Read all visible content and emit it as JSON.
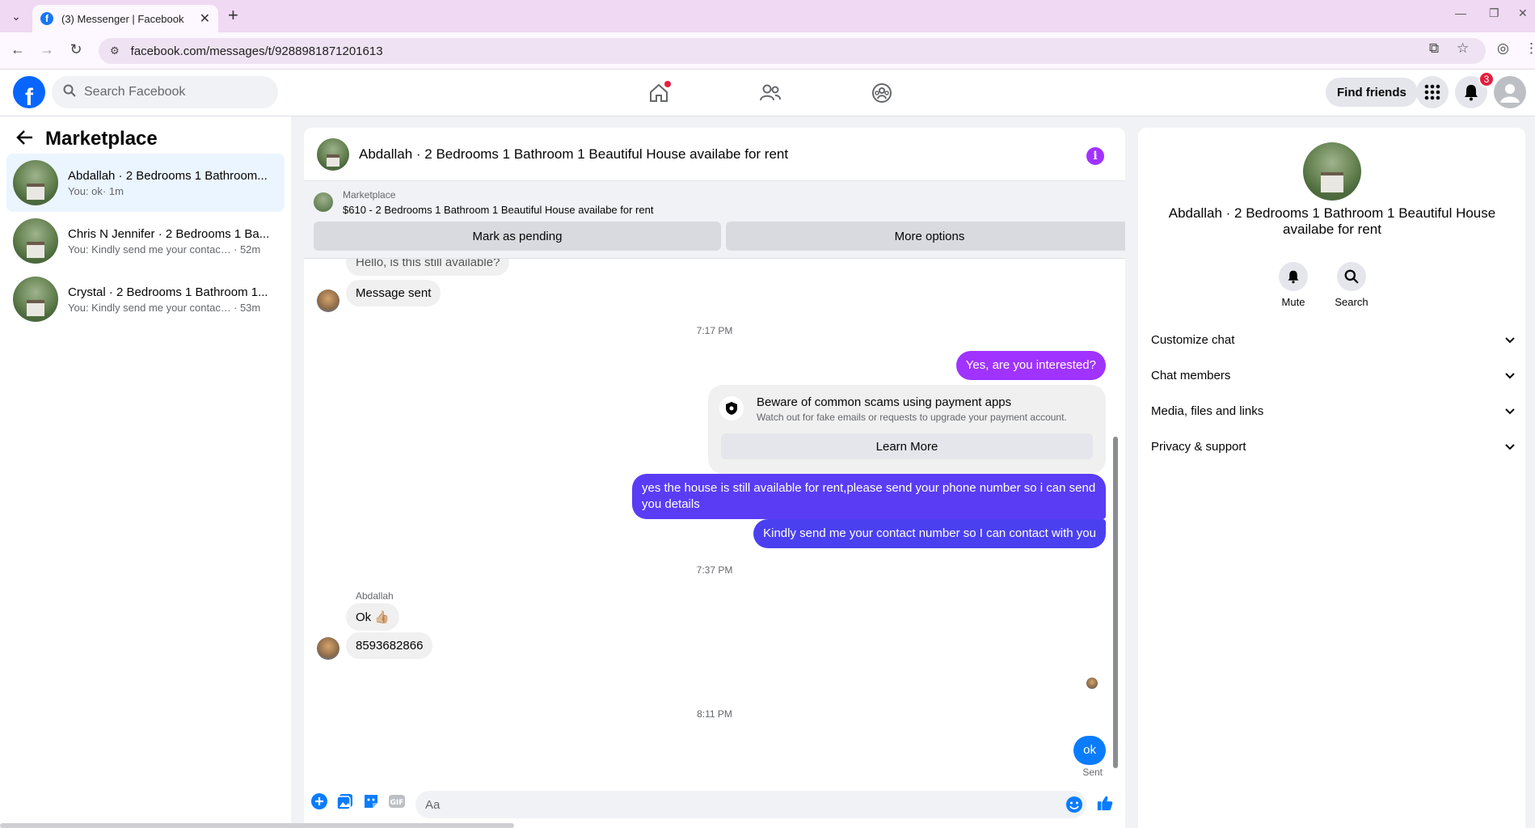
{
  "browser": {
    "tab_title": "(3) Messenger | Facebook",
    "url": "facebook.com/messages/t/9288981871201613",
    "new_tab": "+",
    "close": "✕"
  },
  "header": {
    "search_placeholder": "Search Facebook",
    "find_friends": "Find friends",
    "notification_count": "3"
  },
  "sidebar": {
    "title": "Marketplace",
    "conversations": [
      {
        "name": "Abdallah · 2 Bedrooms 1 Bathroom...",
        "snippet": "You: ok",
        "time": "· 1m",
        "active": true
      },
      {
        "name": "Chris N Jennifer · 2 Bedrooms 1 Ba...",
        "snippet": "You: Kindly send me your contact n...",
        "time": "· 52m",
        "active": false
      },
      {
        "name": "Crystal · 2 Bedrooms 1 Bathroom 1...",
        "snippet": "You: Kindly send me your contact n...",
        "time": "· 53m",
        "active": false
      }
    ]
  },
  "chat": {
    "title": "Abdallah · 2 Bedrooms 1 Bathroom 1 Beautiful House availabe for rent",
    "marketplace_label": "Marketplace",
    "listing": "$610 - 2 Bedrooms 1 Bathroom 1 Beautiful House availabe for rent",
    "mark_pending": "Mark as pending",
    "more_options": "More options",
    "messages": {
      "m0": "Hello, is this still available?",
      "m1": "Message sent",
      "ts1": "7:17 PM",
      "m2": "Yes, are you interested?",
      "scam_title": "Beware of common scams using payment apps",
      "scam_sub": "Watch out for fake emails or requests to upgrade your payment account.",
      "learn_more": "Learn More",
      "m3": "yes the house is still available for rent,please send your  phone number so i can send you details",
      "m4": "Kindly send me your contact number so I can contact with you",
      "ts2": "7:37 PM",
      "sender": "Abdallah",
      "m5": "Ok 👍🏼",
      "m6": "8593682866",
      "ts3": "8:11 PM",
      "m7": "ok",
      "status": "Sent"
    },
    "composer_placeholder": "Aa"
  },
  "details": {
    "name": "Abdallah · 2 Bedrooms 1 Bathroom 1 Beautiful House availabe for rent",
    "mute": "Mute",
    "search": "Search",
    "sections": [
      "Customize chat",
      "Chat members",
      "Media, files and links",
      "Privacy & support"
    ]
  },
  "colors": {
    "purple_bubble": "#a033ff",
    "indigo_bubble": "#5b3cf5",
    "blue_bubble": "#0a7cff",
    "fb_blue": "#0866ff"
  }
}
